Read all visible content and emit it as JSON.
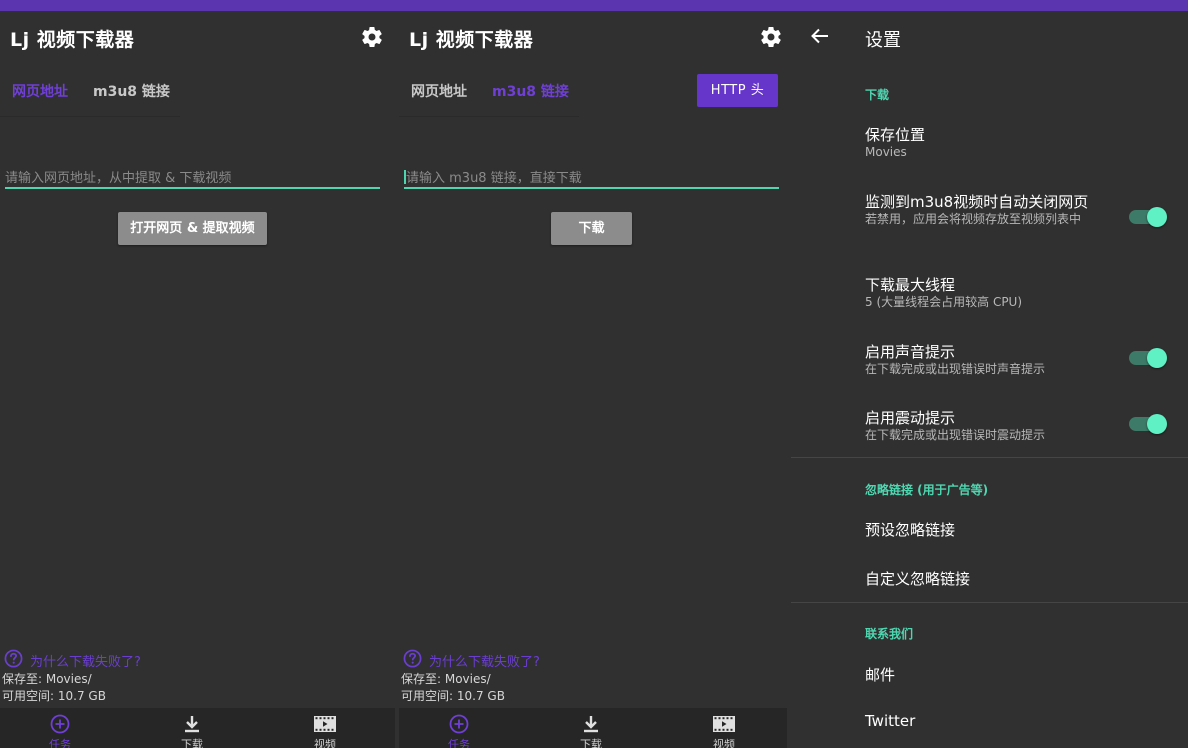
{
  "app": {
    "title": "Lj 视频下载器"
  },
  "screen1": {
    "tabs": [
      "网页地址",
      "m3u8 链接"
    ],
    "active_tab": 0,
    "input_placeholder": "请输入网页地址，从中提取 & 下载视频",
    "action_button": "打开网页 & 提取视频"
  },
  "screen2": {
    "tabs": [
      "网页地址",
      "m3u8 链接"
    ],
    "active_tab": 1,
    "http_button": "HTTP 头",
    "input_placeholder": "请输入 m3u8 链接，直接下载",
    "action_button": "下载"
  },
  "footer": {
    "help_link": "为什么下载失败了?",
    "save_to": "保存至: Movies/",
    "free_space": "可用空间: 10.7 GB"
  },
  "bottom_nav": {
    "items": [
      {
        "label": "任务",
        "icon": "add-circle-icon"
      },
      {
        "label": "下载",
        "icon": "download-icon"
      },
      {
        "label": "视频",
        "icon": "film-icon"
      }
    ],
    "active_index": 0
  },
  "settings": {
    "title": "设置",
    "section_download": "下载",
    "save_location_title": "保存位置",
    "save_location_value": "Movies",
    "auto_close_title": "监测到m3u8视频时自动关闭网页",
    "auto_close_desc": "若禁用，应用会将视频存放至视频列表中",
    "auto_close_enabled": true,
    "max_threads_title": "下载最大线程",
    "max_threads_value": "5 (大量线程会占用较高 CPU)",
    "sound_title": "启用声音提示",
    "sound_desc": "在下载完成或出现错误时声音提示",
    "sound_enabled": true,
    "vibrate_title": "启用震动提示",
    "vibrate_desc": "在下载完成或出现错误时震动提示",
    "vibrate_enabled": true,
    "section_ignore": "忽略链接 (用于广告等)",
    "preset_ignore": "预设忽略链接",
    "custom_ignore": "自定义忽略链接",
    "section_contact": "联系我们",
    "email": "邮件",
    "twitter": "Twitter"
  },
  "colors": {
    "accent_purple": "#6536c9",
    "accent_teal": "#4ed6b0",
    "background": "#303030",
    "status_bar": "#5b35b0"
  }
}
